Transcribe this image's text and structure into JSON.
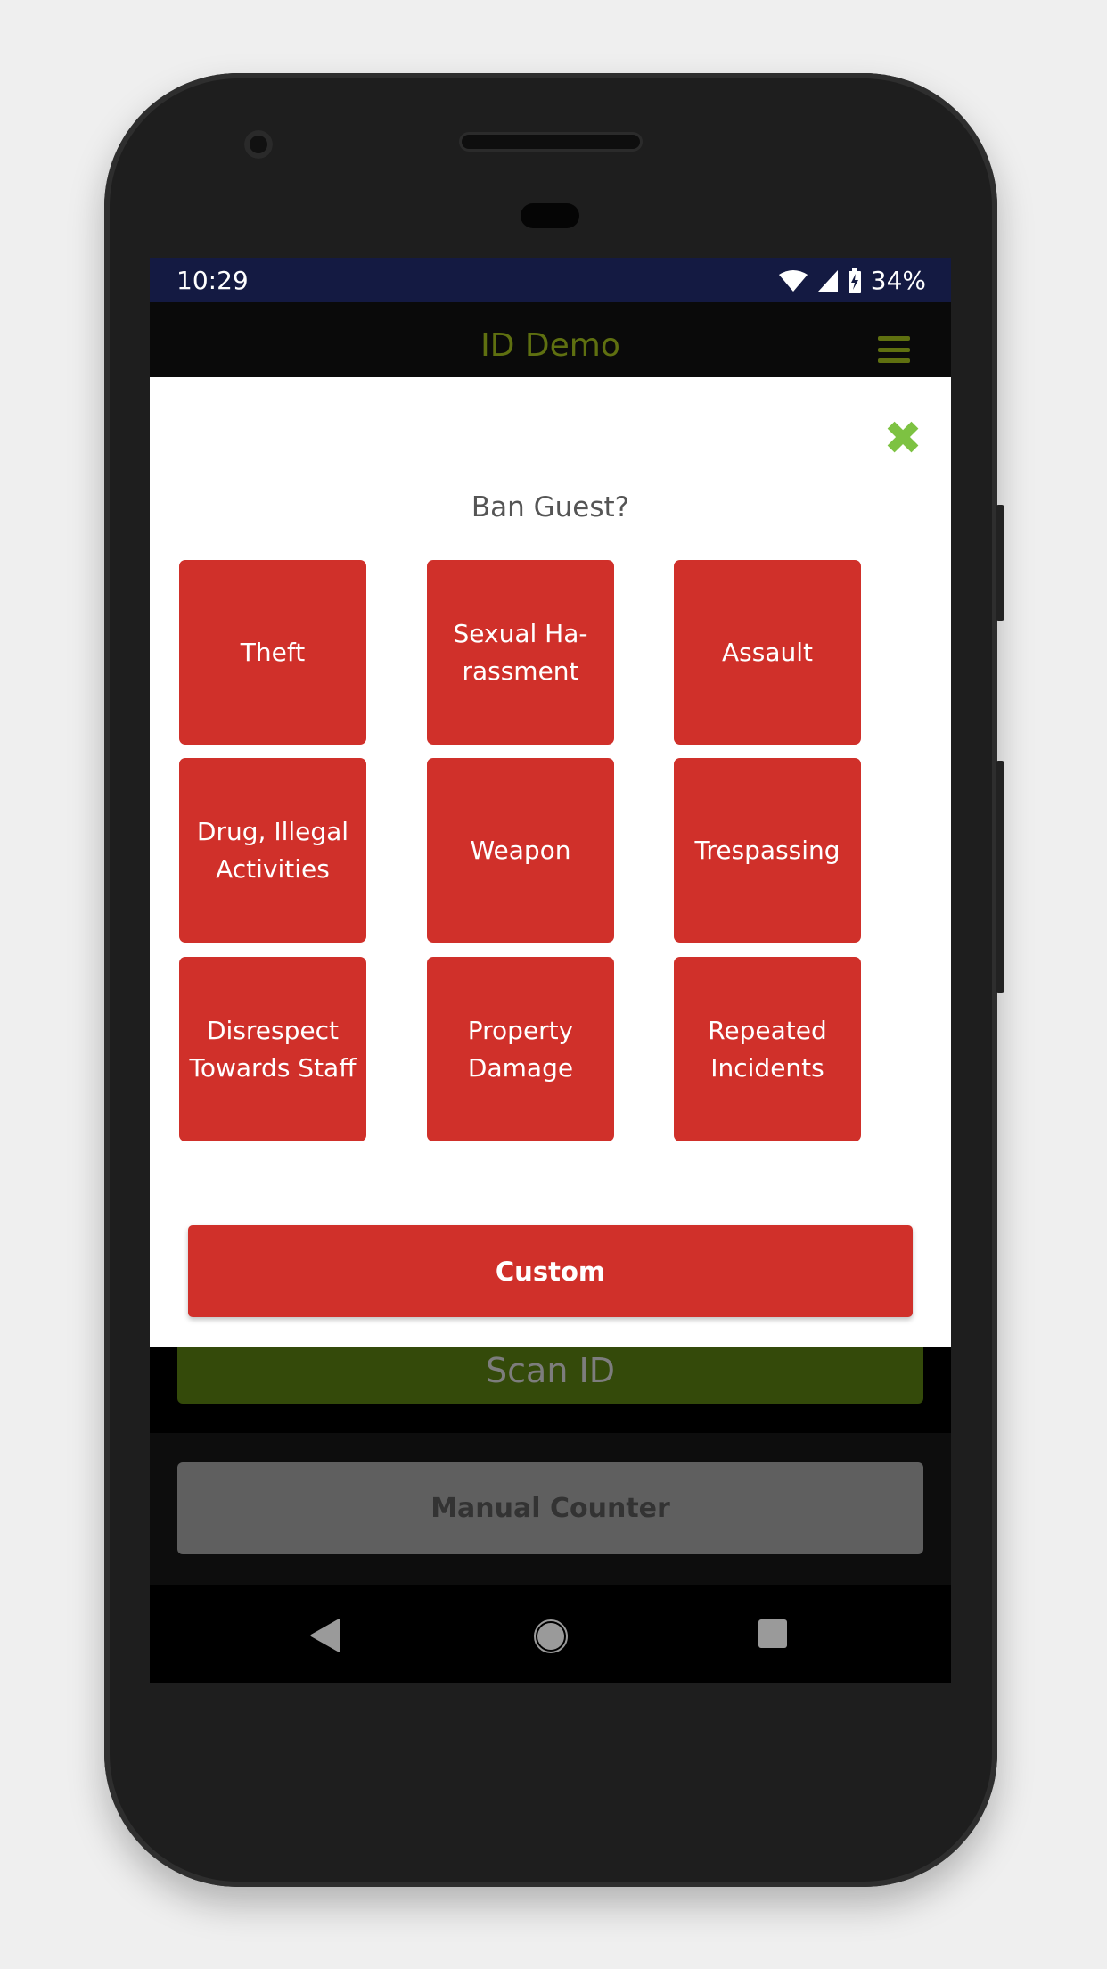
{
  "status_bar": {
    "time": "10:29",
    "battery": "34%"
  },
  "header": {
    "title": "ID Demo"
  },
  "modal": {
    "title": "Ban Guest?",
    "reasons": [
      {
        "label": "Theft"
      },
      {
        "label": "Sexual Ha-rassment"
      },
      {
        "label": "Assault"
      },
      {
        "label": "Drug, Illegal Activities"
      },
      {
        "label": "Weapon"
      },
      {
        "label": "Trespassing"
      },
      {
        "label": "Disrespect Towards Staff"
      },
      {
        "label": "Property Damage"
      },
      {
        "label": "Repeated Incidents"
      }
    ],
    "custom_label": "Custom"
  },
  "main": {
    "scan_label": "Scan ID",
    "manual_label": "Manual Counter"
  },
  "colors": {
    "status_bar": "#141a42",
    "danger": "#d0302a",
    "close": "#7dc242",
    "brand": "#5f7010"
  }
}
